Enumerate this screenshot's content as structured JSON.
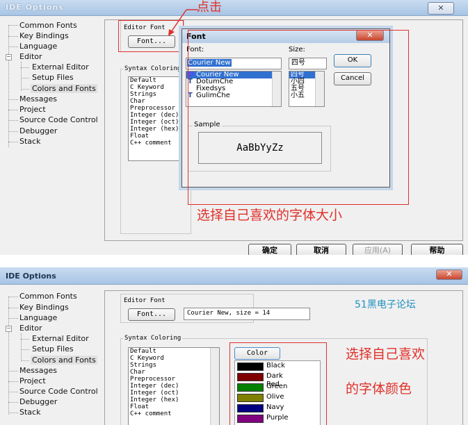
{
  "top": {
    "window_title": "IDE Options",
    "close": "✕",
    "tree": [
      "Common Fonts",
      "Key Bindings",
      "Language",
      "Editor",
      "External Editor",
      "Setup Files",
      "Colors and Fonts",
      "Messages",
      "Project",
      "Source Code Control",
      "Debugger",
      "Stack"
    ],
    "editor_font_label": "Editor Font",
    "font_button": "Font...",
    "syntax_coloring": "Syntax Coloring",
    "syntax_items": [
      "Default",
      "C Keyword",
      "Strings",
      "Char",
      "Preprocessor",
      "Integer (dec)",
      "Integer (oct)",
      "Integer (hex)",
      "Float",
      "C++ comment"
    ],
    "font_dialog": {
      "title": "Font",
      "font_label": "Font:",
      "size_label": "Size:",
      "font_value": "Courier New",
      "size_value": "四号",
      "fonts": [
        "Courier New",
        "DotumChe",
        "Fixedsys",
        "GulimChe"
      ],
      "sizes": [
        "四号",
        "小四",
        "五号",
        "小五"
      ],
      "ok": "OK",
      "cancel": "Cancel",
      "sample_label": "Sample",
      "sample_text": "AaBbYyZz"
    },
    "annotation_click": "点击",
    "annotation_size": "选择自己喜欢的字体大小",
    "buttons": {
      "ok": "确定",
      "cancel": "取消",
      "apply": "应用(A)",
      "help": "帮助"
    }
  },
  "bottom": {
    "window_title": "IDE Options",
    "close": "✕",
    "tree": [
      "Common Fonts",
      "Key Bindings",
      "Language",
      "Editor",
      "External Editor",
      "Setup Files",
      "Colors and Fonts",
      "Messages",
      "Project",
      "Source Code Control",
      "Debugger",
      "Stack"
    ],
    "editor_font_label": "Editor Font",
    "font_button": "Font...",
    "font_desc": "Courier New, size = 14",
    "syntax_coloring": "Syntax Coloring",
    "syntax_items": [
      "Default",
      "C Keyword",
      "Strings",
      "Char",
      "Preprocessor",
      "Integer (dec)",
      "Integer (oct)",
      "Integer (hex)",
      "Float",
      "C++ comment"
    ],
    "color_button": "Color",
    "colors": [
      {
        "name": "Black",
        "hex": "#000000"
      },
      {
        "name": "Dark Red",
        "hex": "#800000"
      },
      {
        "name": "Green",
        "hex": "#008000"
      },
      {
        "name": "Olive",
        "hex": "#808000"
      },
      {
        "name": "Navy",
        "hex": "#000080"
      },
      {
        "name": "Purple",
        "hex": "#800080"
      }
    ],
    "watermark": "51黑电子论坛",
    "annotation_color_1": "选择自己喜欢",
    "annotation_color_2": "的字体颜色"
  }
}
